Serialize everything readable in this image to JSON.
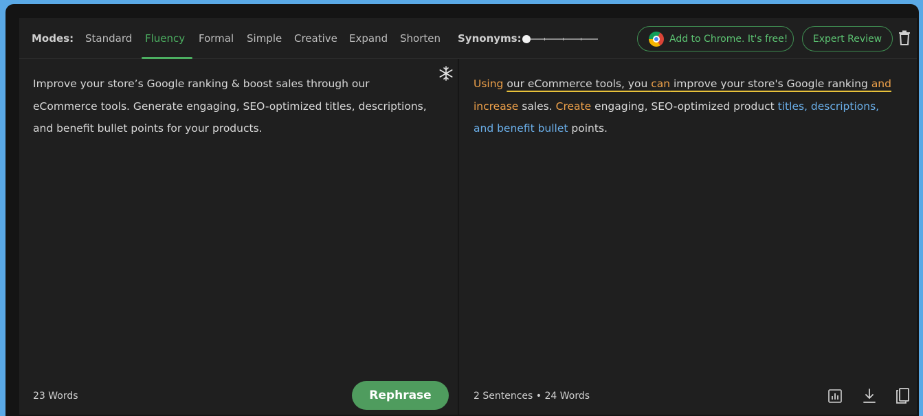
{
  "toolbar": {
    "modes_label": "Modes:",
    "modes": [
      {
        "label": "Standard",
        "active": false
      },
      {
        "label": "Fluency",
        "active": true
      },
      {
        "label": "Formal",
        "active": false
      },
      {
        "label": "Simple",
        "active": false
      },
      {
        "label": "Creative",
        "active": false
      },
      {
        "label": "Expand",
        "active": false
      },
      {
        "label": "Shorten",
        "active": false
      }
    ],
    "synonyms_label": "Synonyms:",
    "synonyms_level": 0,
    "chrome_button": "Add to Chrome. It's free!",
    "expert_button": "Expert Review",
    "icons": {
      "trash": "trash-icon",
      "chrome": "chrome-logo-icon"
    }
  },
  "input_panel": {
    "text": "Improve your store’s Google ranking & boost sales through our eCommerce tools. Generate engaging, SEO-optimized titles, descriptions, and benefit bullet points for your products.",
    "word_count": "23 Words",
    "rephrase_button": "Rephrase",
    "icons": {
      "freeze": "snowflake-icon"
    }
  },
  "output_panel": {
    "segments": [
      {
        "text": "Using",
        "style": "orange"
      },
      {
        "text": " ",
        "style": "plain"
      },
      {
        "text": "our eCommerce tools, you ",
        "style": "underline"
      },
      {
        "text": "can",
        "style": "orange-underline"
      },
      {
        "text": " improve your store's Google ranking ",
        "style": "underline"
      },
      {
        "text": "and",
        "style": "orange-underline"
      },
      {
        "text": " ",
        "style": "plain"
      },
      {
        "text": "increase",
        "style": "orange"
      },
      {
        "text": " sales. ",
        "style": "plain"
      },
      {
        "text": "Create",
        "style": "orange"
      },
      {
        "text": " engaging, SEO-optimized product ",
        "style": "plain"
      },
      {
        "text": "titles, descriptions, and benefit bullet",
        "style": "blue"
      },
      {
        "text": " points.",
        "style": "plain"
      }
    ],
    "stats": {
      "sentences": "2 Sentences",
      "separator": "•",
      "words": "24 Words"
    },
    "icons": {
      "stats": "bar-chart-icon",
      "download": "download-icon",
      "copy": "copy-icon"
    }
  },
  "colors": {
    "accent": "#4caf61",
    "changed_word": "#f0a24a",
    "structural_change": "#6aaee8",
    "longest_unchanged": "#e8c13a"
  }
}
